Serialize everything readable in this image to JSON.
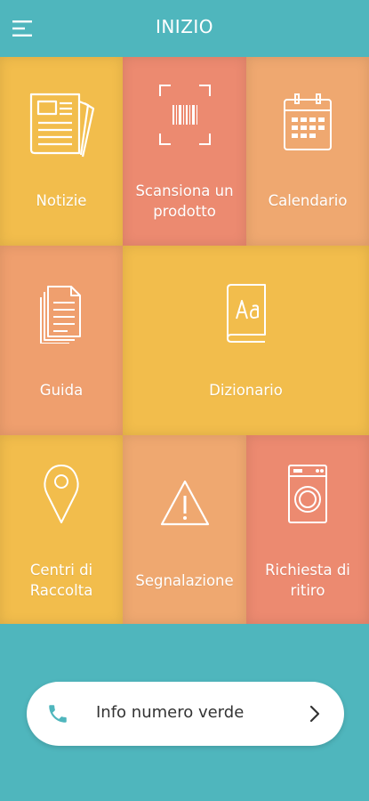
{
  "header": {
    "title": "INIZIO"
  },
  "tiles": [
    {
      "label": "Notizie",
      "icon": "newspaper-icon",
      "color": "#f2bd4c"
    },
    {
      "label": "Scansiona un prodotto",
      "icon": "barcode-scan-icon",
      "color": "#ec8a70"
    },
    {
      "label": "Calendario",
      "icon": "calendar-icon",
      "color": "#efa870"
    },
    {
      "label": "Guida",
      "icon": "document-icon",
      "color": "#ef9f6e"
    },
    {
      "label": "Dizionario",
      "icon": "dictionary-icon",
      "color": "#f2bd4c"
    },
    {
      "label": "Centri di Raccolta",
      "icon": "map-pin-icon",
      "color": "#f2bd4c"
    },
    {
      "label": "Segnalazione",
      "icon": "warning-icon",
      "color": "#efa870"
    },
    {
      "label": "Richiesta di ritiro",
      "icon": "washing-machine-icon",
      "color": "#ec8a70"
    }
  ],
  "info_bar": {
    "label": "Info numero verde",
    "icon": "phone-icon",
    "arrow_icon": "chevron-right-icon"
  },
  "colors": {
    "teal": "#4fb6bd",
    "yellow": "#f2bd4c",
    "salmon": "#ec8a70",
    "peach": "#efa870",
    "phone_icon": "#4fb6bd"
  }
}
